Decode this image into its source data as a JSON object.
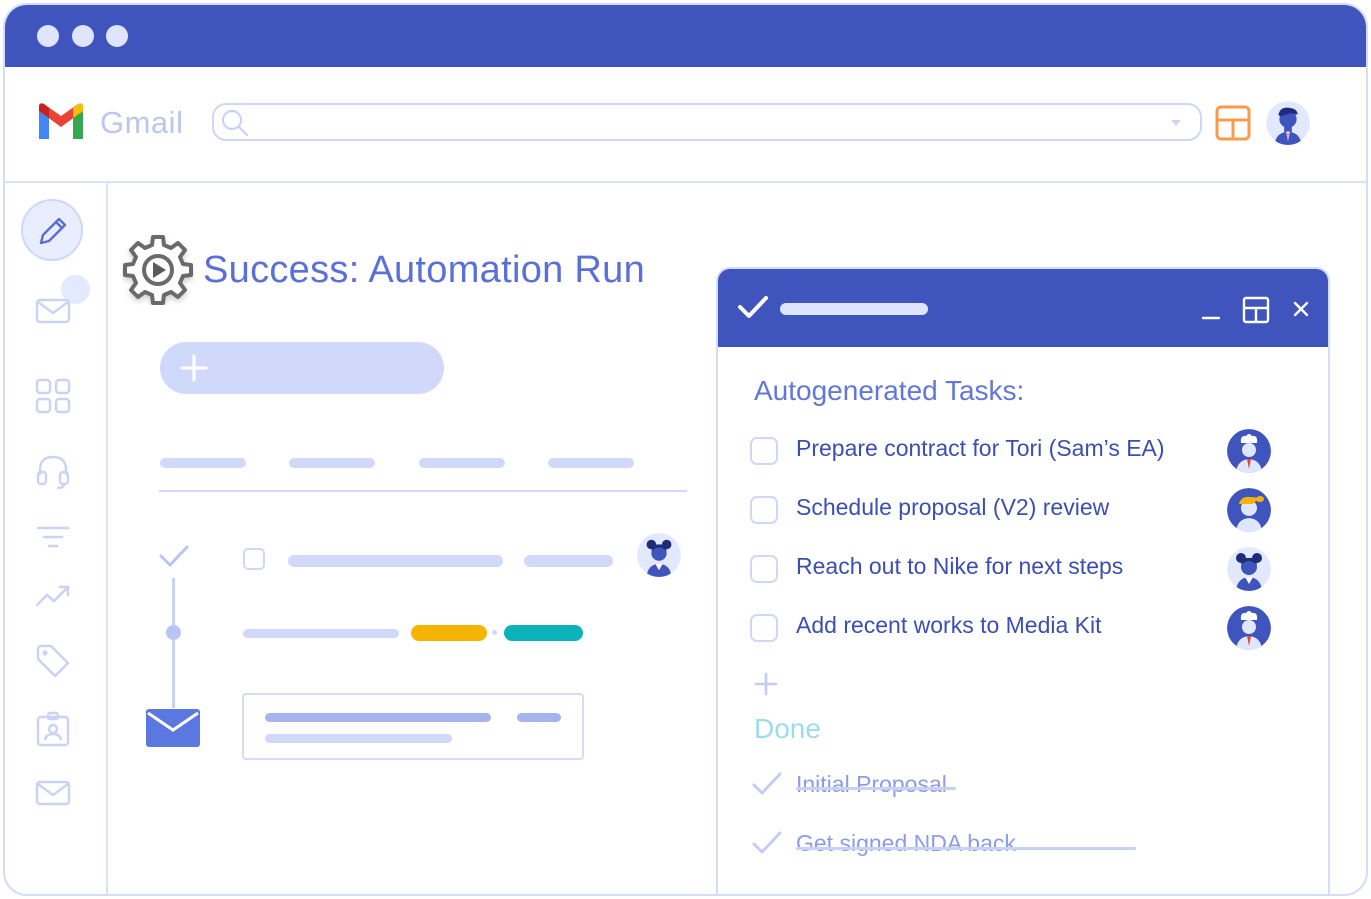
{
  "window": {
    "title_bar_color": "#3f54bc",
    "traffic_dots": [
      "dot",
      "dot",
      "dot"
    ]
  },
  "gmail": {
    "logo_text": "Gmail",
    "search": {
      "placeholder": "",
      "icon": "search-icon",
      "dropdown_icon": "chevron-down-icon"
    },
    "layout_icon": "layout-icon",
    "avatar": "user-avatar"
  },
  "sidebar": {
    "items": [
      "pencil-icon",
      "mail-icon",
      "apps-grid-icon",
      "headset-icon",
      "filter-icon",
      "trending-icon",
      "tag-icon",
      "contact-card-icon",
      "mail-icon"
    ]
  },
  "main": {
    "title": "Success: Automation Run",
    "title_icon": "gear-play-icon",
    "new_button_icon": "plus-icon",
    "tag_colors": [
      "#f5b400",
      "#0bb3b8"
    ]
  },
  "tasks_panel": {
    "header_icon": "check-icon",
    "controls": [
      "minimize-icon",
      "layout-icon",
      "close-icon"
    ],
    "section_title": "Autogenerated Tasks:",
    "tasks": [
      {
        "label": "Prepare contract for Tori (Sam’s EA)",
        "avatar": "avatar-chef"
      },
      {
        "label": "Schedule proposal (V2) review",
        "avatar": "avatar-blonde"
      },
      {
        "label": "Reach out to Nike for next steps",
        "avatar": "avatar-buns"
      },
      {
        "label": "Add recent works to Media Kit",
        "avatar": "avatar-chef"
      }
    ],
    "add_icon": "plus-icon",
    "done_title": "Done",
    "done": [
      {
        "label": "Initial Proposal"
      },
      {
        "label": "Get signed NDA back"
      }
    ]
  }
}
